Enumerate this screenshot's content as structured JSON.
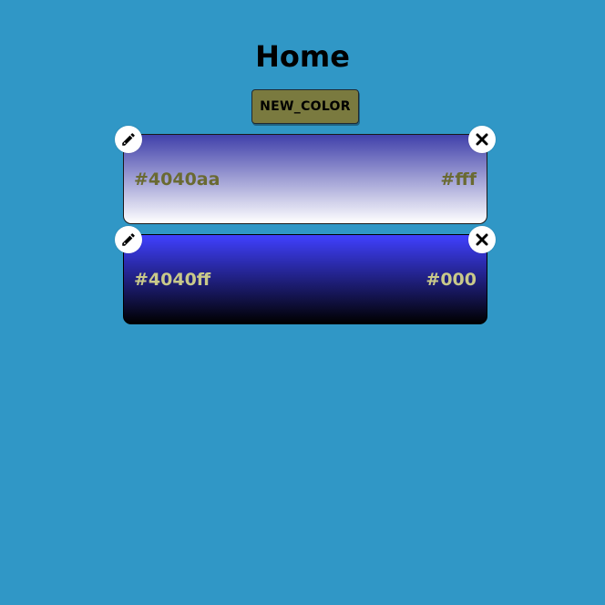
{
  "page": {
    "title": "Home"
  },
  "toolbar": {
    "new_color_label": "NEW_COLOR"
  },
  "colors": [
    {
      "start": "#4040aa",
      "end": "#fff",
      "label_color": "#6a6a32"
    },
    {
      "start": "#4040ff",
      "end": "#000",
      "label_color": "#c9c98a"
    }
  ],
  "icons": {
    "edit": "pencil-icon",
    "delete": "close-icon"
  },
  "theme": {
    "background": "#3097c6",
    "button_bg": "#7a7a3f"
  }
}
